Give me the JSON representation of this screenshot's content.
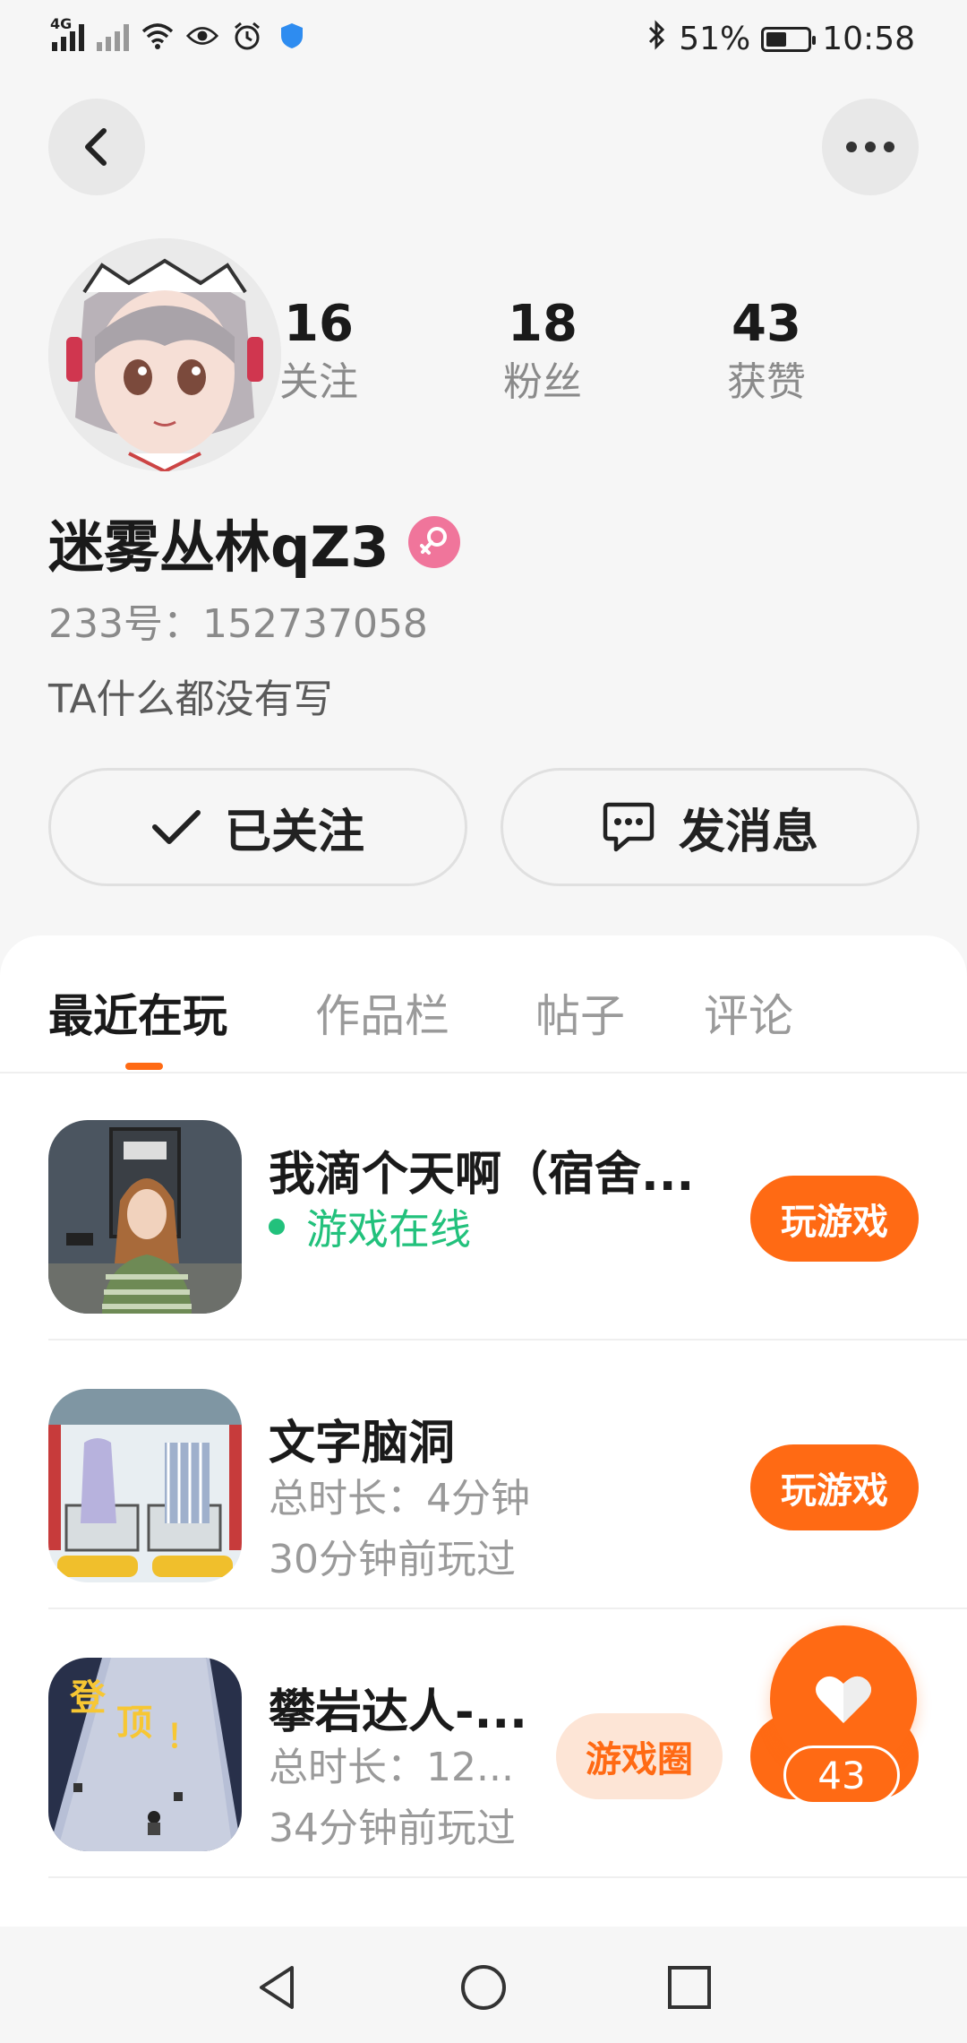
{
  "status_bar": {
    "network_1": "4G",
    "battery_percent": "51%",
    "battery_level": 0.51,
    "time": "10:58"
  },
  "header": {
    "back_icon": "back-arrow-icon",
    "more_icon": "more-dots-icon"
  },
  "profile": {
    "stats": [
      {
        "value": "16",
        "label": "关注"
      },
      {
        "value": "18",
        "label": "粉丝"
      },
      {
        "value": "43",
        "label": "获赞"
      }
    ],
    "username": "迷雾丛林qZ3",
    "gender_icon": "female-icon",
    "id_line": "233号：152737058",
    "bio": "TA什么都没有写",
    "follow_label": "已关注",
    "message_label": "发消息"
  },
  "tabs": [
    {
      "label": "最近在玩",
      "active": true
    },
    {
      "label": "作品栏",
      "active": false
    },
    {
      "label": "帖子",
      "active": false
    },
    {
      "label": "评论",
      "active": false
    }
  ],
  "games": [
    {
      "title": "我滴个天啊（宿舍...",
      "status": "游戏在线",
      "play_label": "玩游戏"
    },
    {
      "title": "文字脑洞",
      "duration": "总时长：4分钟",
      "last_played": "30分钟前玩过",
      "play_label": "玩游戏"
    },
    {
      "title": "攀岩达人-...",
      "duration": "总时长：12...",
      "last_played": "34分钟前玩过",
      "circle_label": "游戏圈",
      "thumb_text_1": "登",
      "thumb_text_2": "顶",
      "thumb_text_3": "！"
    }
  ],
  "like_fab": {
    "count": "43"
  },
  "colors": {
    "accent": "#ff6a14",
    "online": "#22c17c",
    "gender": "#f0759b"
  }
}
